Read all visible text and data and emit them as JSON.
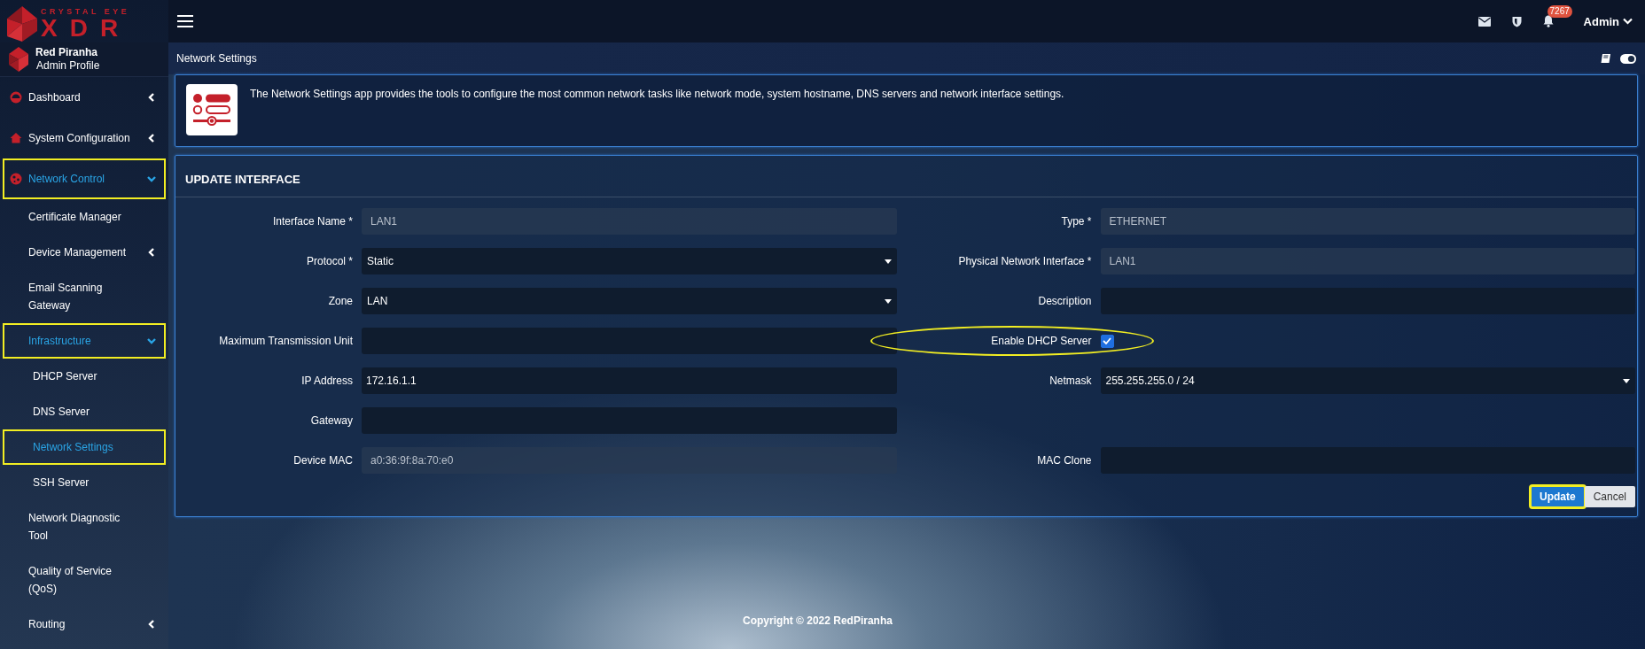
{
  "brand": {
    "tagline": "CRYSTAL EYE",
    "name": "XDR"
  },
  "profile": {
    "name": "Red Piranha",
    "role": "Admin Profile"
  },
  "sidebar": {
    "items": [
      {
        "label": "Dashboard",
        "kind": "group",
        "expanded": false,
        "selected": false,
        "highlighted": false
      },
      {
        "label": "System Configuration",
        "kind": "group",
        "expanded": false,
        "selected": false,
        "highlighted": false
      },
      {
        "label": "Network Control",
        "kind": "group",
        "expanded": true,
        "selected": true,
        "highlighted": true,
        "children": [
          {
            "label": "Certificate Manager",
            "kind": "link",
            "selected": false,
            "highlighted": false
          },
          {
            "label": "Device Management",
            "kind": "group",
            "expanded": false,
            "selected": false,
            "highlighted": false
          },
          {
            "label": "Email Scanning Gateway",
            "kind": "link",
            "selected": false,
            "highlighted": false
          },
          {
            "label": "Infrastructure",
            "kind": "group",
            "expanded": true,
            "selected": true,
            "highlighted": true,
            "children": [
              {
                "label": "DHCP Server",
                "kind": "link",
                "selected": false,
                "highlighted": false
              },
              {
                "label": "DNS Server",
                "kind": "link",
                "selected": false,
                "highlighted": false
              },
              {
                "label": "Network Settings",
                "kind": "link",
                "selected": true,
                "highlighted": true
              },
              {
                "label": "SSH Server",
                "kind": "link",
                "selected": false,
                "highlighted": false
              }
            ]
          },
          {
            "label": "Network Diagnostic Tool",
            "kind": "link",
            "selected": false,
            "highlighted": false
          },
          {
            "label": "Quality of Service (QoS)",
            "kind": "link",
            "selected": false,
            "highlighted": false
          },
          {
            "label": "Routing",
            "kind": "group",
            "expanded": false,
            "selected": false,
            "highlighted": false
          }
        ]
      }
    ]
  },
  "topbar": {
    "notification_count": "7267",
    "user": "Admin"
  },
  "page": {
    "title": "Network Settings",
    "description": "The Network Settings app provides the tools to configure the most common network tasks like network mode, system hostname, DNS servers and network interface settings."
  },
  "form": {
    "title": "UPDATE INTERFACE",
    "rows": [
      {
        "left": {
          "label": "Interface Name *",
          "kind": "text",
          "value": "LAN1",
          "readonly": true
        },
        "right": {
          "label": "Type *",
          "kind": "text",
          "value": "ETHERNET",
          "readonly": true
        }
      },
      {
        "left": {
          "label": "Protocol *",
          "kind": "select",
          "value": "Static"
        },
        "right": {
          "label": "Physical Network Interface *",
          "kind": "text",
          "value": "LAN1",
          "readonly": true
        }
      },
      {
        "left": {
          "label": "Zone",
          "kind": "select",
          "value": "LAN"
        },
        "right": {
          "label": "Description",
          "kind": "text",
          "readonly": false
        }
      },
      {
        "left": {
          "label": "Maximum Transmission Unit",
          "kind": "text",
          "readonly": false
        },
        "right": {
          "label": "Enable DHCP Server",
          "kind": "checkbox",
          "checked": true,
          "highlighted": true
        }
      },
      {
        "left": {
          "label": "IP Address",
          "kind": "text",
          "value": "172.16.1.1",
          "readonly": false
        },
        "right": {
          "label": "Netmask",
          "kind": "select",
          "value": "255.255.255.0 / 24"
        }
      },
      {
        "left": {
          "label": "Gateway",
          "kind": "text",
          "readonly": false
        }
      },
      {
        "left": {
          "label": "Device MAC",
          "kind": "text",
          "value": "a0:36:9f:8a:70:e0",
          "readonly": true
        },
        "right": {
          "label": "MAC Clone",
          "kind": "text",
          "readonly": false
        }
      }
    ],
    "buttons": [
      {
        "label": "Update",
        "kind": "primary",
        "highlighted": true
      },
      {
        "label": "Cancel",
        "kind": "secondary",
        "highlighted": false
      }
    ]
  },
  "footer": {
    "copyright": "Copyright © 2022 RedPiranha"
  }
}
